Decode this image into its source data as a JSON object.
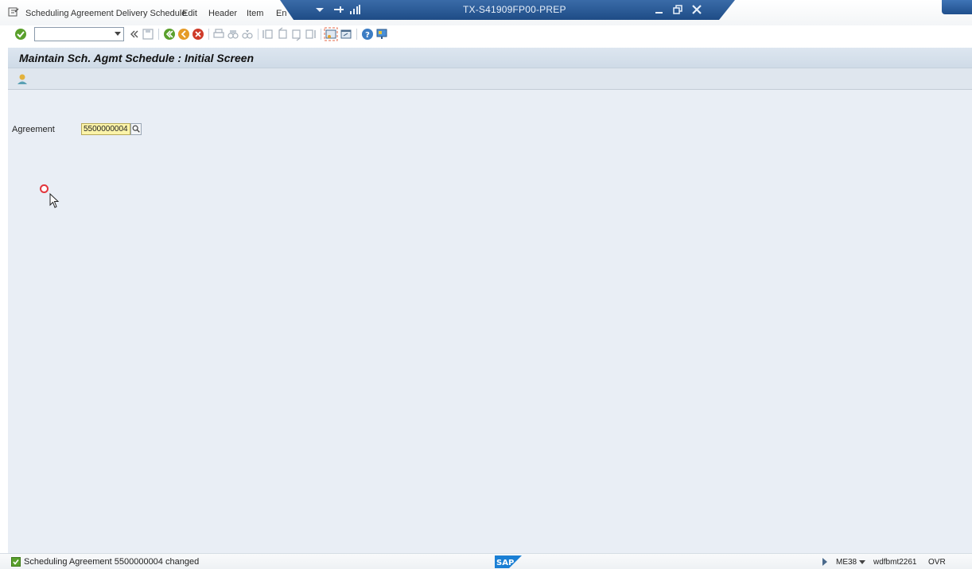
{
  "menubar": {
    "items": [
      "Scheduling Agreement Delivery Schedule",
      "Edit",
      "Header",
      "Item",
      "En"
    ]
  },
  "titlebar": {
    "system_title": "TX-S41909FP00-PREP"
  },
  "screen": {
    "title": "Maintain Sch. Agmt Schedule : Initial Screen"
  },
  "form": {
    "agreement_label": "Agreement",
    "agreement_value": "5500000004"
  },
  "statusbar": {
    "message": "Scheduling Agreement 5500000004 changed",
    "transaction": "ME38",
    "server": "wdfbmt2261",
    "mode": "OVR"
  },
  "colors": {
    "title_blue": "#1e4c86",
    "field_yellow": "#fbf3a8",
    "success_green": "#5aa02c",
    "click_red": "#e2353c"
  }
}
